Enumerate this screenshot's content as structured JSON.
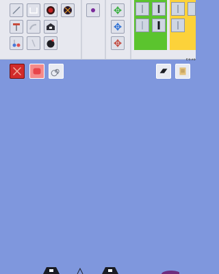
{
  "toolbar": {
    "tools_row1": [
      "pencil-icon",
      "frame-icon",
      "red-bomb-icon",
      "fireworks-icon"
    ],
    "tools_row2": [
      "hammer-icon",
      "pipe-icon",
      "robot-icon"
    ],
    "tools_row3": [
      "flasks-icon",
      "wand-icon",
      "black-bomb-icon"
    ],
    "color_tool": "purple-dot-icon",
    "move_tools": [
      "move-green-icon",
      "move-blue-icon",
      "move-red-icon"
    ],
    "green_panel_color": "#5bc42e",
    "yellow_panel_color": "#fcd23a"
  },
  "counter": "5848",
  "actions": {
    "delete": "close-icon",
    "stop": "stop-icon",
    "spiral": "spiral-icon",
    "eraser": "eraser-icon",
    "scroll": "scroll-icon"
  },
  "colors": {
    "canvas": "#7f97dd",
    "toolbar": "#e7e8ef",
    "delete_bg": "#d12b2b",
    "stop_bg": "#f48b8b"
  }
}
